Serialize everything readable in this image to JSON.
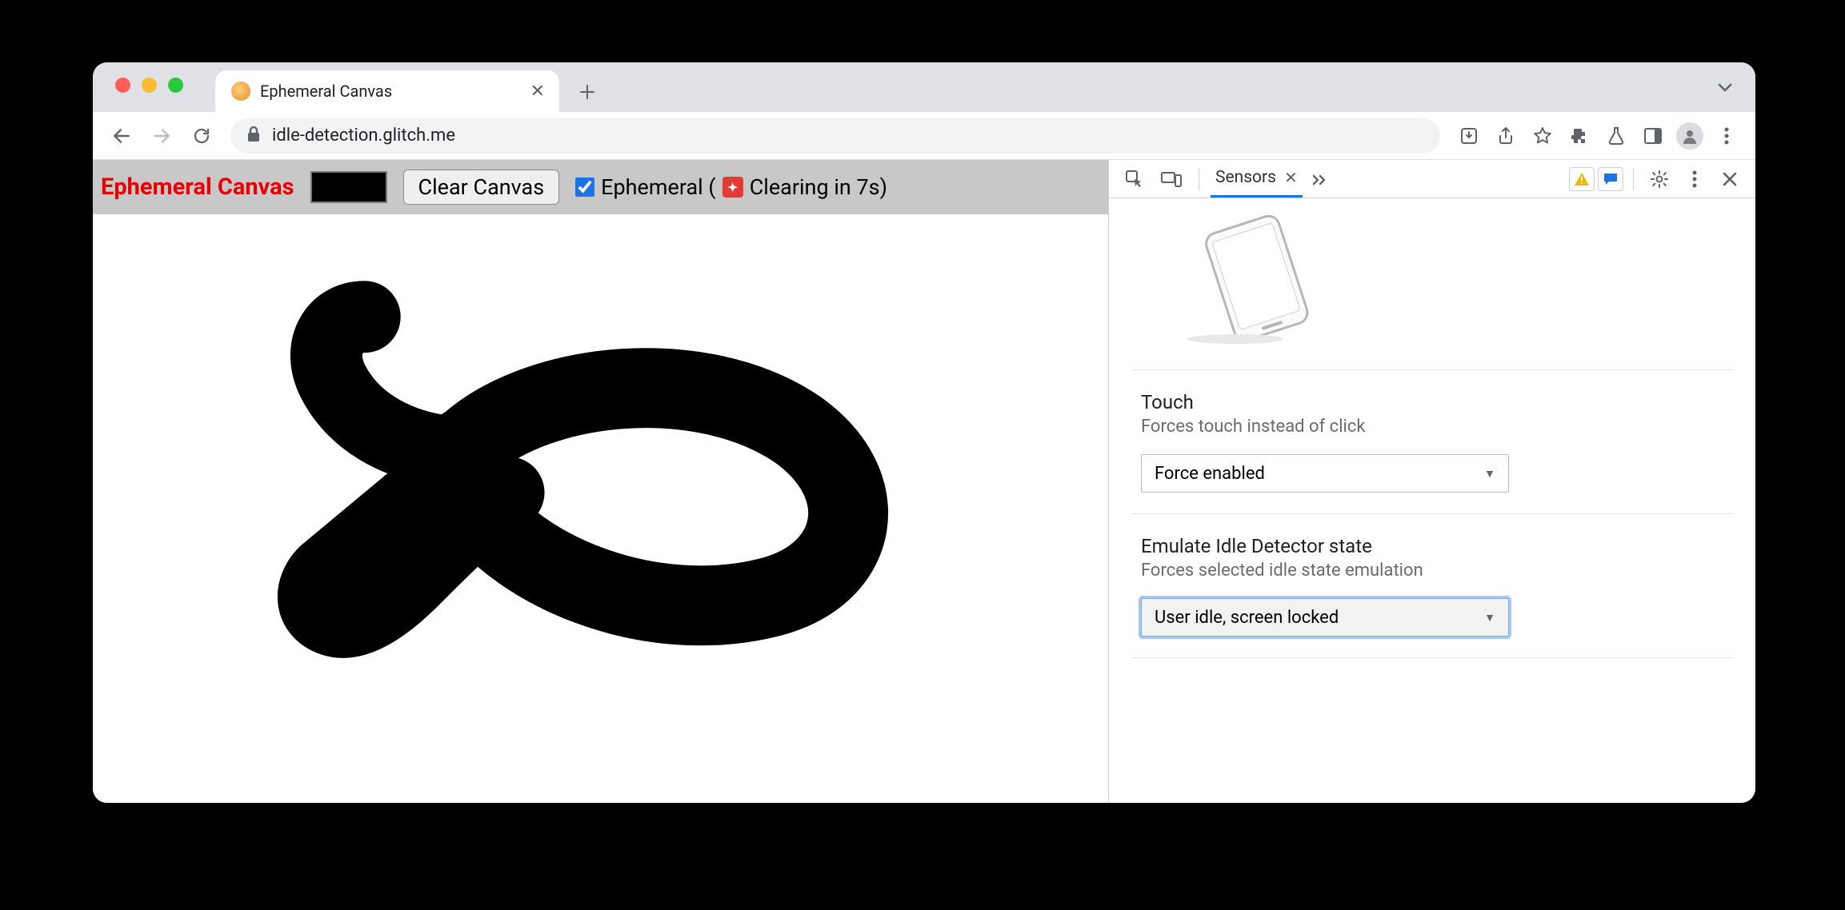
{
  "browser": {
    "tab_title": "Ephemeral Canvas",
    "url": "idle-detection.glitch.me"
  },
  "page": {
    "title": "Ephemeral Canvas",
    "clear_button": "Clear Canvas",
    "ephemeral_label_prefix": "Ephemeral (",
    "clearing_text": "Clearing in 7s)",
    "checkbox_checked": true,
    "color_value": "#000000"
  },
  "devtools": {
    "active_tab": "Sensors",
    "device_preview_alt": "Tilted phone orientation preview",
    "sections": {
      "touch": {
        "title": "Touch",
        "desc": "Forces touch instead of click",
        "value": "Force enabled"
      },
      "idle": {
        "title": "Emulate Idle Detector state",
        "desc": "Forces selected idle state emulation",
        "value": "User idle, screen locked"
      }
    }
  }
}
